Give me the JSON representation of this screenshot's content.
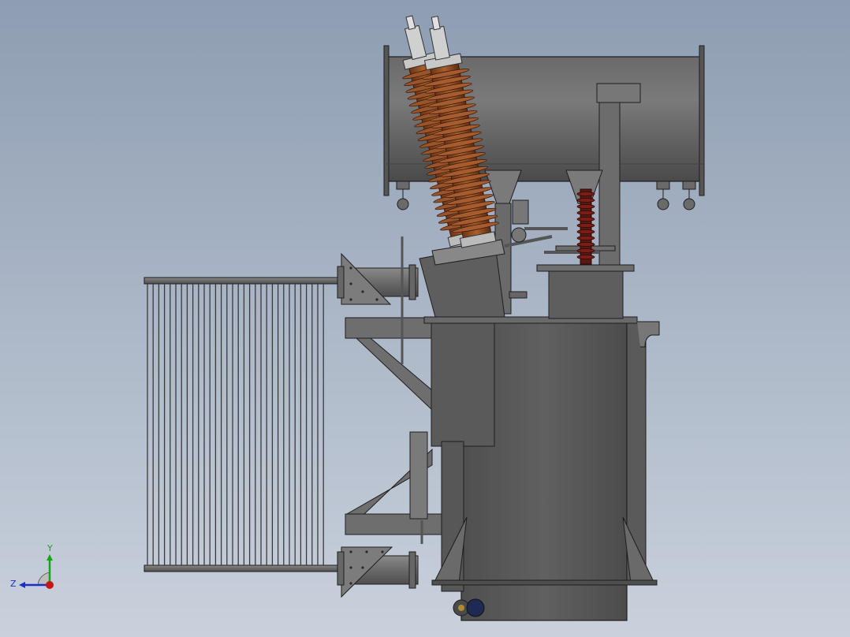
{
  "viewport": {
    "background_top": "#8e9db2",
    "background_bottom": "#c9d1dc"
  },
  "model": {
    "tank_color": "#5e5e5e",
    "steel_color": "#6f6f6f",
    "edge_color": "#1e1e1e",
    "bushing_color": "#8a4a22",
    "arrester_color": "#6e1a14",
    "radiator_fin_color": "#3a3a3a"
  },
  "triad": {
    "y_label": "Y",
    "z_label": "Z",
    "x_color": "#c81414",
    "y_color": "#12a812",
    "z_color": "#1a2fc8"
  }
}
